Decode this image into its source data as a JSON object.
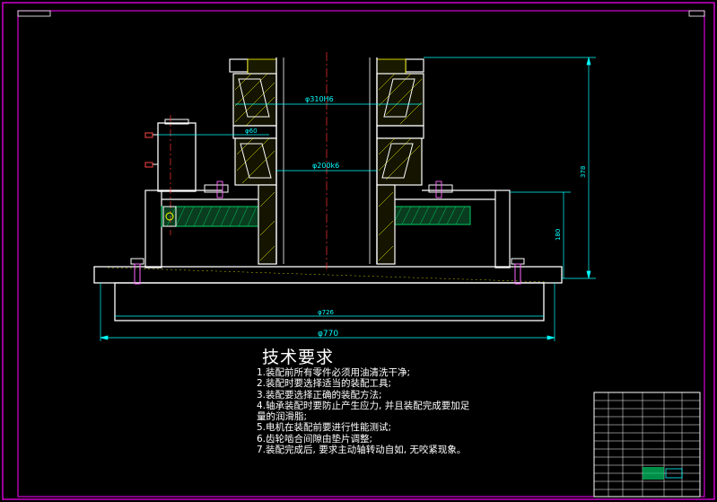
{
  "dimensions": {
    "bore_fit": "φ310H6",
    "small_dia": "φ60",
    "shaft_fit": "φ200k6",
    "height_total": "378",
    "height_base": "180",
    "inner_dia": "φ726",
    "outer_dia": "φ770"
  },
  "requirements": {
    "title": "技术要求",
    "items": [
      "1.装配前所有零件必须用油清洗干净;",
      "2.装配时要选择适当的装配工具;",
      "3.装配要选择正确的装配方法;",
      "4.轴承装配时要防止产生应力, 并且装配完成要加足",
      "量的润滑脂;",
      "5.电机在装配前要进行性能测试;",
      "6.齿轮啮合间隙由垫片调整;",
      "7.装配完成后, 要求主动轴转动自如, 无咬紧现象。"
    ]
  },
  "colors": {
    "frame": "#ff00ff",
    "outline": "#ffffff",
    "dimension": "#00ffff",
    "hatch": "#ffff00",
    "gear": "#00cc66",
    "centerline": "#ff3333"
  }
}
